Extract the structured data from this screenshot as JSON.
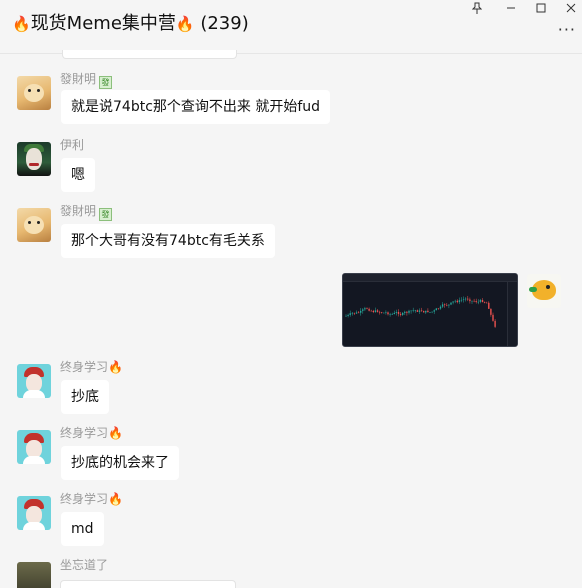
{
  "window": {
    "title_text": "现货Meme集中营",
    "member_count": "(239)",
    "pin_icon": "pin-icon",
    "minimize_icon": "minimize-icon",
    "maximize_icon": "maximize-icon",
    "close_icon": "close-icon",
    "more_icon": "more-icon"
  },
  "messages": [
    {
      "sender": "發財明",
      "badge": "發",
      "text": "就是说74btc那个查询不出来 就开始fud",
      "avatar": "dog-avatar"
    },
    {
      "sender": "伊利",
      "text": "嗯",
      "avatar": "joker-avatar"
    },
    {
      "sender": "發財明",
      "badge": "發",
      "text": "那个大哥有没有74btc有毛关系",
      "avatar": "dog-avatar"
    },
    {
      "sender": "self",
      "image": "trading-chart-screenshot",
      "avatar": "bird-avatar"
    },
    {
      "sender": "终身学习",
      "text": "抄底",
      "avatar": "cap-avatar"
    },
    {
      "sender": "终身学习",
      "text": "抄底的机会来了",
      "avatar": "cap-avatar"
    },
    {
      "sender": "终身学习",
      "text": "md",
      "avatar": "cap-avatar"
    },
    {
      "sender": "坐忘道了",
      "avatar": "dark-avatar"
    }
  ],
  "colors": {
    "background": "#f5f5f5",
    "bubble": "#ffffff",
    "sender_name": "#9a9a9a",
    "chart_bg": "#131722"
  }
}
